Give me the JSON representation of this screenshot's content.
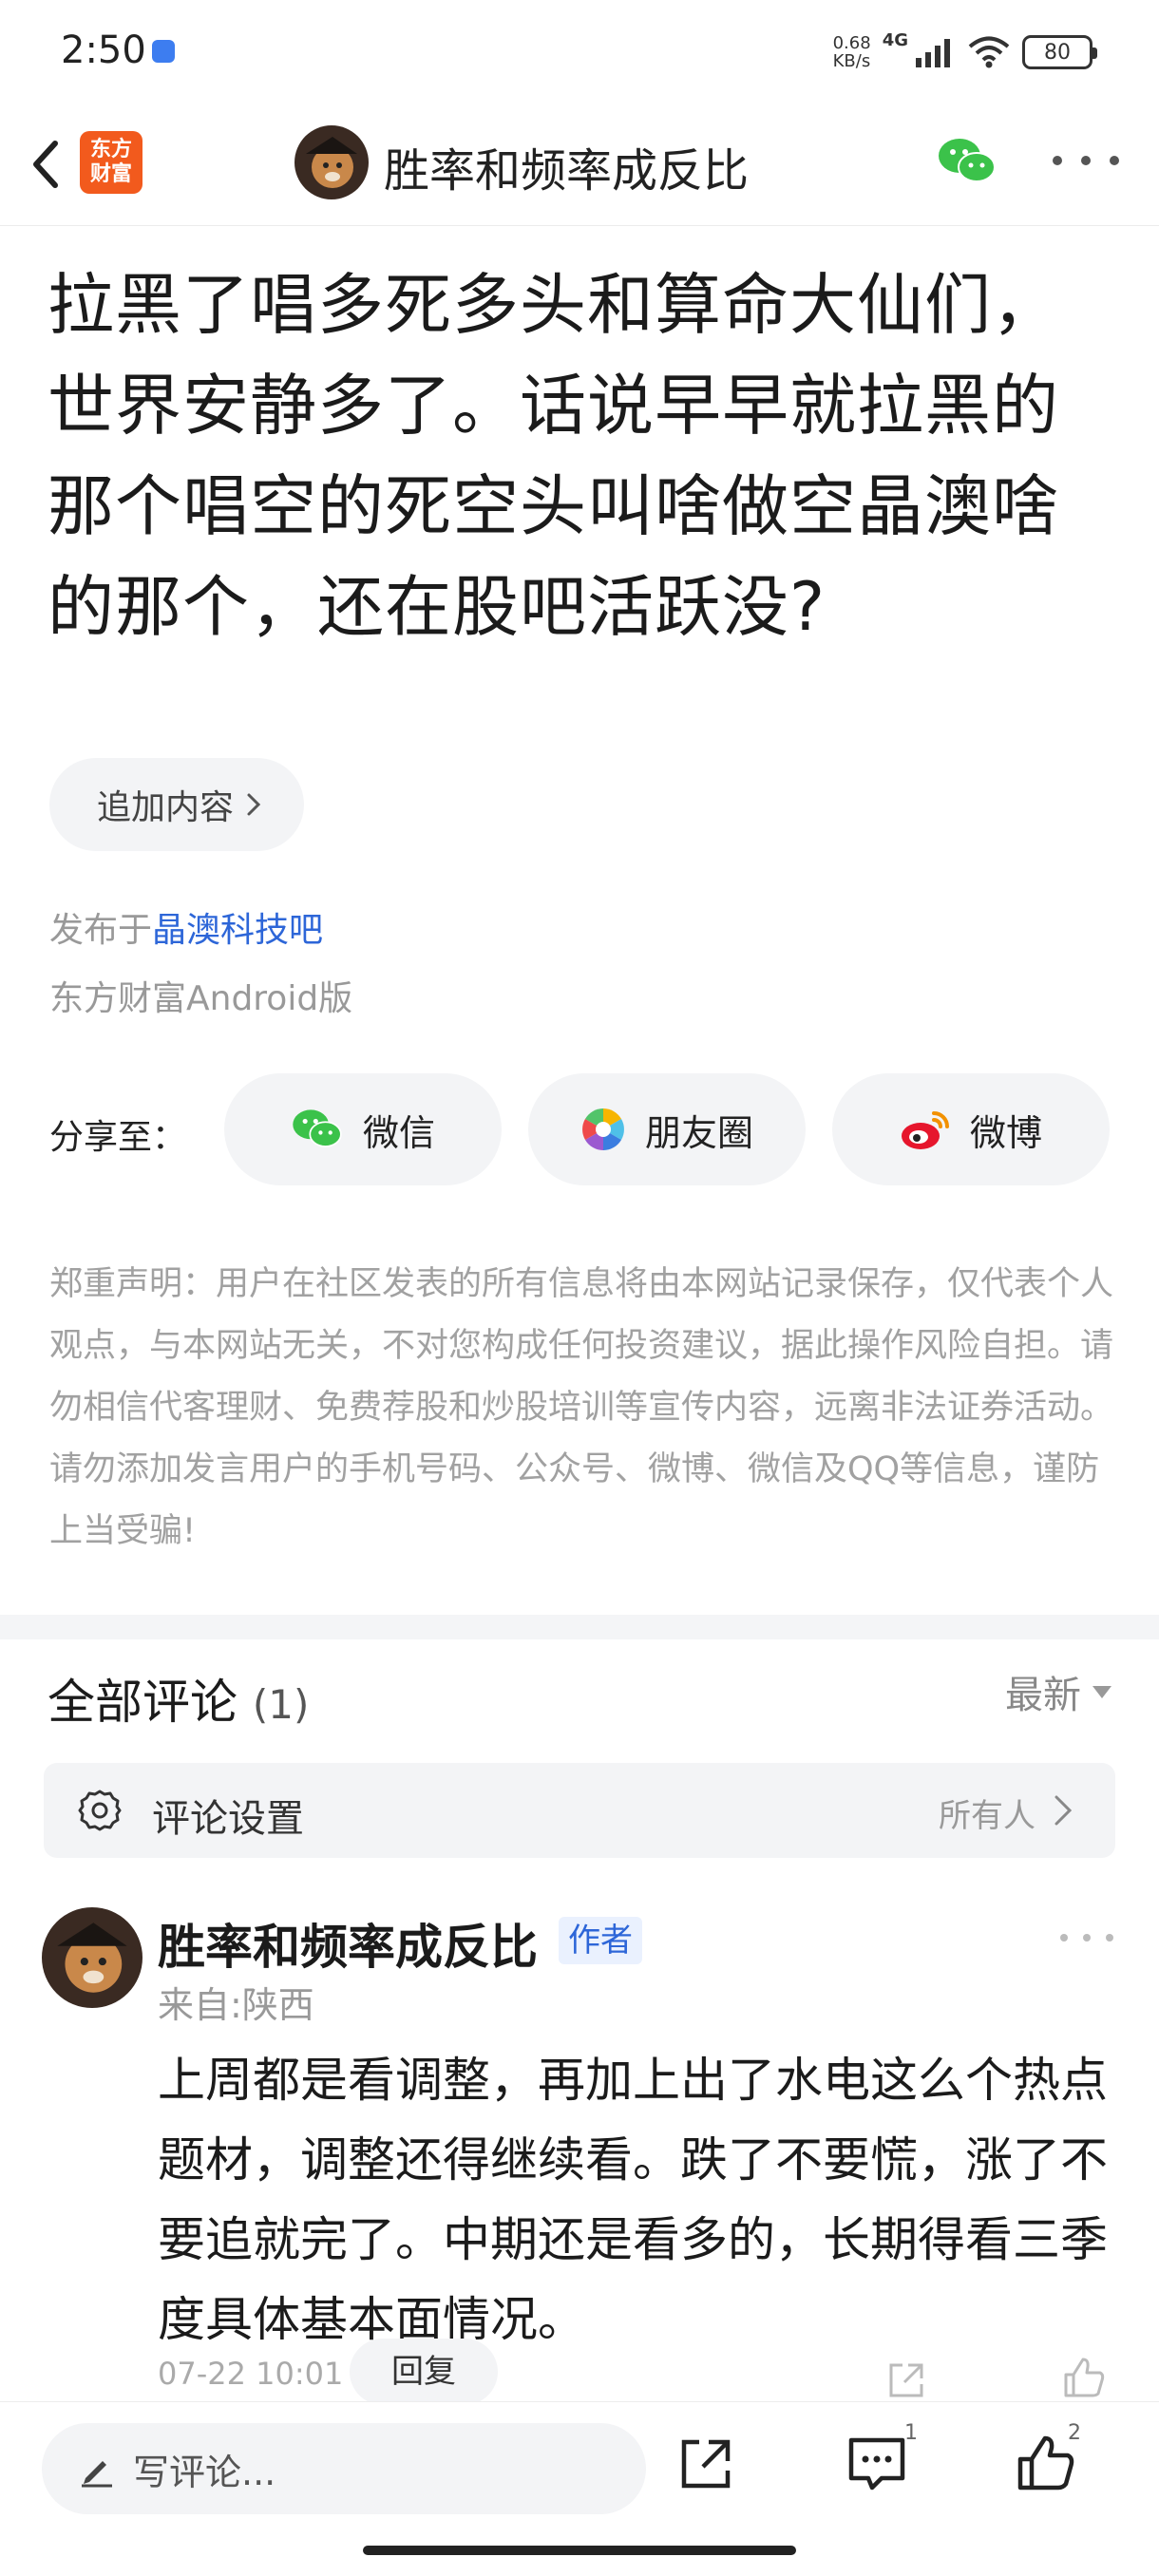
{
  "status_bar": {
    "time": "2:50",
    "net_speed_value": "0.68",
    "net_speed_unit": "KB/s",
    "network_type": "4G",
    "battery": "80"
  },
  "nav": {
    "brand_logo_text": "东方财富",
    "title": "胜率和频率成反比"
  },
  "post": {
    "title": "拉黑了唱多死多头和算命大仙们，世界安静多了。话说早早就拉黑的那个唱空的死空头叫啥做空晶澳啥的那个，还在股吧活跃没?",
    "append_label": "追加内容",
    "published_prefix": "发布于",
    "bar_name": "晶澳科技吧",
    "platform": "东方财富Android版"
  },
  "share": {
    "label": "分享至：",
    "options": [
      {
        "label": "微信",
        "icon": "wechat-icon"
      },
      {
        "label": "朋友圈",
        "icon": "moments-icon"
      },
      {
        "label": "微博",
        "icon": "weibo-icon"
      }
    ]
  },
  "disclaimer": "郑重声明：用户在社区发表的所有信息将由本网站记录保存，仅代表个人观点，与本网站无关，不对您构成任何投资建议，据此操作风险自担。请勿相信代客理财、免费荐股和炒股培训等宣传内容，远离非法证券活动。请勿添加发言用户的手机号码、公众号、微博、微信及QQ等信息，谨防上当受骗!",
  "comments": {
    "title": "全部评论",
    "count": "(1)",
    "sort_label": "最新",
    "settings_label": "评论设置",
    "settings_value": "所有人",
    "items": [
      {
        "author": "胜率和频率成反比",
        "badge": "作者",
        "location": "来自:陕西",
        "text": "上周都是看调整，再加上出了水电这么个热点题材，调整还得继续看。跌了不要慌，涨了不要追就完了。中期还是看多的，长期得看三季度具体基本面情况。",
        "time": "07-22 10:01",
        "reply_label": "回复"
      }
    ]
  },
  "bottom_bar": {
    "write_placeholder": "写评论...",
    "comment_count": "1",
    "like_count": "2"
  },
  "colors": {
    "brand_orange": "#f25a1d",
    "link_blue": "#2d66d8",
    "wechat_green": "#3bc24a",
    "weibo_red": "#e6162d"
  }
}
